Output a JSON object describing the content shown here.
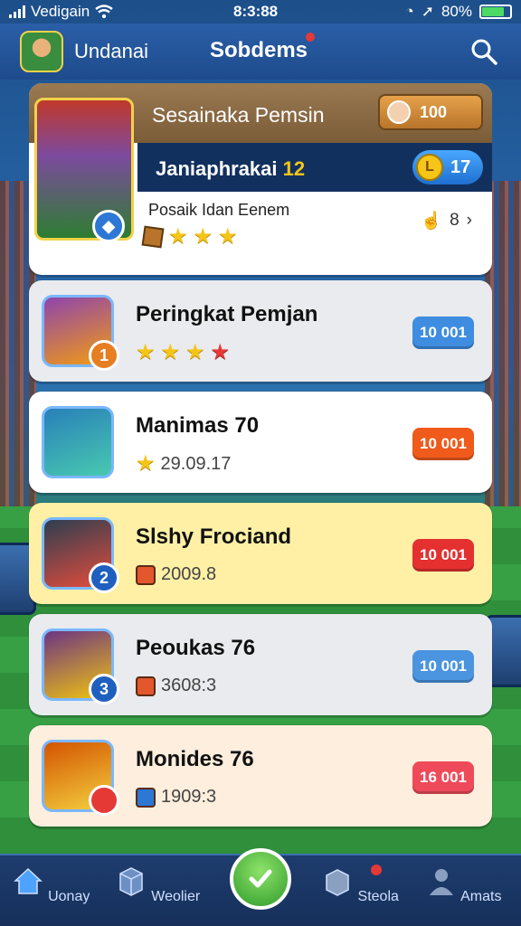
{
  "status_bar": {
    "carrier": "Vedigain",
    "time": "8:3:88",
    "battery_text": "80%"
  },
  "header": {
    "username": "Undanai",
    "title": "Sobdems"
  },
  "featured": {
    "name": "Sesainaka Pemsin",
    "coins": "100",
    "level_label": "Janiaphrakai",
    "level_value": "12",
    "level_badge_value": "17",
    "description": "Posaik Idan Eenem",
    "meta": "8",
    "stars": 3
  },
  "players": [
    {
      "name": "Peringkat Pemjan",
      "sub": "",
      "badge": "10 001",
      "rank": "1",
      "stars": 4,
      "badge_color": "#3e8de0",
      "card_bg": "#e9ebee",
      "rank_color": "#e67e22"
    },
    {
      "name": "Manimas 70",
      "sub": "29.09.17",
      "badge": "10 001",
      "rank": "",
      "stars": 1,
      "badge_color": "#f05a1a",
      "card_bg": "#ffffff",
      "rank_color": ""
    },
    {
      "name": "Slshy Frociand",
      "sub": "2009.8",
      "badge": "10 001",
      "rank": "2",
      "stars": 0,
      "badge_color": "#e53030",
      "card_bg": "#fff0a6",
      "rank_color": "#1f5fbf"
    },
    {
      "name": "Peoukas 76",
      "sub": "3608:3",
      "badge": "10 001",
      "rank": "3",
      "stars": 0,
      "badge_color": "#4a94e0",
      "card_bg": "#e9ebee",
      "rank_color": "#1f5fbf"
    },
    {
      "name": "Monides 76",
      "sub": "1909:3",
      "badge": "16 001",
      "rank": "",
      "stars": 0,
      "badge_color": "#ef4a5a",
      "card_bg": "#fdeedd",
      "rank_color": "#e53935"
    }
  ],
  "nav": {
    "items": [
      {
        "label": "Uonay",
        "icon": "home-icon"
      },
      {
        "label": "Weolier",
        "icon": "cube-icon"
      },
      {
        "label": "Steola",
        "icon": "box-icon"
      },
      {
        "label": "Amats",
        "icon": "person-icon"
      }
    ],
    "play_icon": "check-icon"
  },
  "colors": {
    "header": "#1e4b8c",
    "accent_gold": "#f5c518"
  }
}
